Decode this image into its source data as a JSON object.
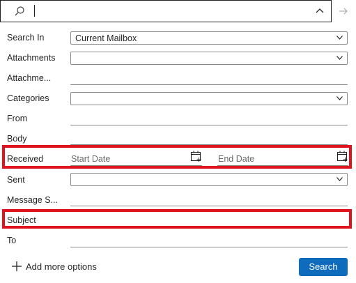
{
  "search_bar": {
    "query": ""
  },
  "fields": {
    "search_in": {
      "label": "Search In",
      "value": "Current Mailbox"
    },
    "attachments": {
      "label": "Attachments",
      "value": ""
    },
    "attachment_name": {
      "label": "Attachme...",
      "value": ""
    },
    "categories": {
      "label": "Categories",
      "value": ""
    },
    "from": {
      "label": "From",
      "value": ""
    },
    "body": {
      "label": "Body",
      "value": ""
    },
    "received": {
      "label": "Received",
      "start_placeholder": "Start Date",
      "end_placeholder": "End Date"
    },
    "sent": {
      "label": "Sent",
      "value": ""
    },
    "message_size": {
      "label": "Message S...",
      "value": ""
    },
    "subject": {
      "label": "Subject",
      "value": ""
    },
    "to": {
      "label": "To",
      "value": ""
    }
  },
  "footer": {
    "add_options_label": "Add more options",
    "search_button_label": "Search"
  },
  "colors": {
    "accent": "#0f6cbd",
    "highlight": "#e0141e"
  },
  "icons": [
    "search-icon",
    "chevron-up-icon",
    "arrow-right-icon",
    "chevron-down-icon",
    "calendar-icon",
    "plus-icon"
  ]
}
